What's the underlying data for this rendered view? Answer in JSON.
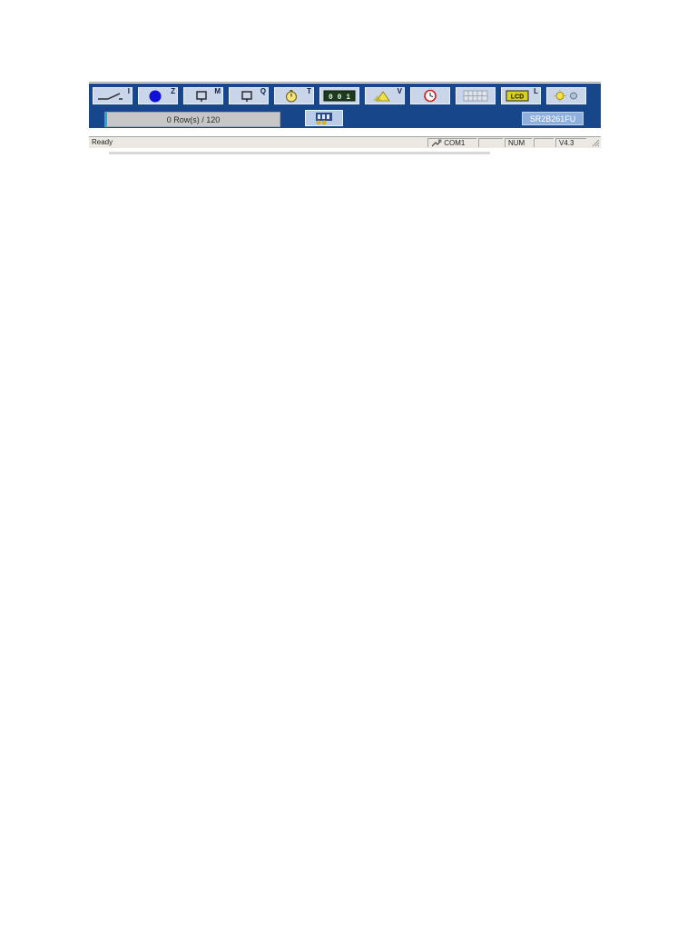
{
  "toolbar": {
    "buttons": [
      {
        "name": "inputs-button",
        "icon": "contact-switch-icon",
        "label": "I"
      },
      {
        "name": "key-input-button",
        "icon": "blue-disc-icon",
        "label": "Z"
      },
      {
        "name": "aux-relay-button",
        "icon": "relay-coil-icon",
        "label": "M"
      },
      {
        "name": "outputs-button",
        "icon": "relay-coil-icon",
        "label": "Q"
      },
      {
        "name": "timer-button",
        "icon": "stopwatch-icon",
        "label": "T"
      },
      {
        "name": "counter-button",
        "icon": "counter-display-icon",
        "label": ""
      },
      {
        "name": "analog-compare-button",
        "icon": "analog-triangle-icon",
        "label": "V"
      },
      {
        "name": "rtc-button",
        "icon": "clock-icon",
        "label": ""
      },
      {
        "name": "text-button",
        "icon": "grid-panel-icon",
        "label": ""
      },
      {
        "name": "lcd-button",
        "icon": "lcd-icon",
        "label": "L"
      },
      {
        "name": "backlight-button",
        "icon": "lamp-icon",
        "label": ""
      }
    ],
    "counter_text": "0 0 1",
    "lcd_text": "LCD"
  },
  "panel": {
    "rows_text": "0 Row(s) / 120",
    "model": "SR2B261FU"
  },
  "status": {
    "text": "Ready",
    "port": "COM1",
    "num": "NUM",
    "version": "V4.3"
  },
  "colors": {
    "toolbar_bg": "#17478a",
    "button_bg": "#c9d6ea",
    "status_bg": "#ece9e2"
  }
}
